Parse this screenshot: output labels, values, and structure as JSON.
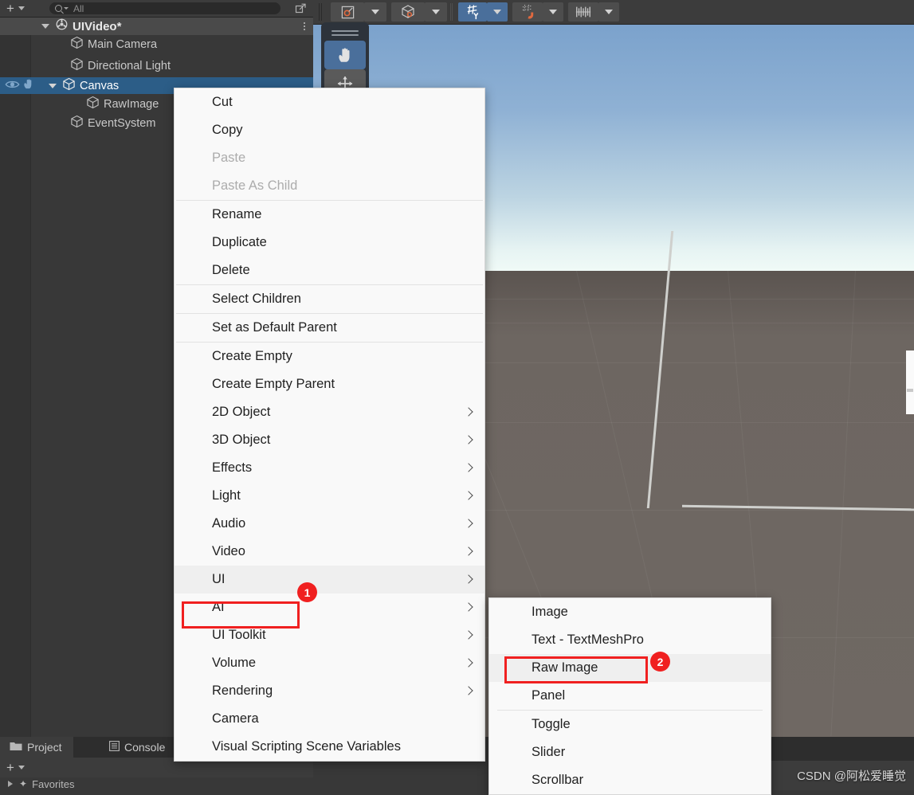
{
  "hierarchy": {
    "toolbar": {
      "add_label": "+",
      "search_value": "",
      "search_placeholder": "All",
      "expand_icon": "open-in-new-icon"
    },
    "scene_name": "UIVideo*",
    "items": [
      {
        "label": "Main Camera",
        "indent": 2,
        "selected": false,
        "expandable": false
      },
      {
        "label": "Directional Light",
        "indent": 2,
        "selected": false,
        "expandable": false
      },
      {
        "label": "Canvas",
        "indent": 2,
        "selected": true,
        "expandable": true
      },
      {
        "label": "RawImage",
        "indent": 3,
        "selected": false,
        "expandable": false
      },
      {
        "label": "EventSystem",
        "indent": 2,
        "selected": false,
        "expandable": false
      }
    ]
  },
  "project_panel": {
    "tabs": [
      {
        "label": "Project",
        "icon": "folder-icon",
        "active": true
      },
      {
        "label": "Console",
        "icon": "console-icon",
        "active": false
      }
    ],
    "add_label": "+",
    "favorites_label": "Favorites"
  },
  "scene_toolbar": {
    "buttons": [
      {
        "name": "gizmo-toggle",
        "icon": "gizmo-icon",
        "state": "normal"
      },
      {
        "name": "gizmo-dropdown",
        "icon": "chevron-down-icon",
        "state": "normal"
      },
      {
        "name": "render-mode",
        "icon": "cube-wire-icon",
        "state": "normal"
      },
      {
        "name": "render-mode-dropdown",
        "icon": "chevron-down-icon",
        "state": "normal"
      },
      {
        "name": "grid-snap-toggle",
        "icon": "grid-y-icon",
        "state": "active"
      },
      {
        "name": "grid-snap-dropdown",
        "icon": "chevron-down-icon",
        "state": "active"
      },
      {
        "name": "magnet-snap-toggle",
        "icon": "magnet-grid-icon",
        "state": "normal"
      },
      {
        "name": "magnet-snap-dropdown",
        "icon": "chevron-down-icon",
        "state": "normal"
      },
      {
        "name": "increment-snap",
        "icon": "ruler-icon",
        "state": "normal"
      },
      {
        "name": "increment-snap-dropdown",
        "icon": "chevron-down-icon",
        "state": "normal"
      }
    ]
  },
  "tool_palette": {
    "tools": [
      {
        "name": "hand-tool",
        "icon": "hand-icon",
        "selected": true
      },
      {
        "name": "move-tool",
        "icon": "move-arrows-icon",
        "selected": false
      }
    ]
  },
  "context_menu": {
    "items": [
      {
        "label": "Cut",
        "type": "item",
        "disabled": false,
        "submenu": false,
        "highlighted": false
      },
      {
        "label": "Copy",
        "type": "item",
        "disabled": false,
        "submenu": false,
        "highlighted": false
      },
      {
        "label": "Paste",
        "type": "item",
        "disabled": true,
        "submenu": false,
        "highlighted": false
      },
      {
        "label": "Paste As Child",
        "type": "item",
        "disabled": true,
        "submenu": false,
        "highlighted": false
      },
      {
        "label": "",
        "type": "separator"
      },
      {
        "label": "Rename",
        "type": "item",
        "disabled": false,
        "submenu": false,
        "highlighted": false
      },
      {
        "label": "Duplicate",
        "type": "item",
        "disabled": false,
        "submenu": false,
        "highlighted": false
      },
      {
        "label": "Delete",
        "type": "item",
        "disabled": false,
        "submenu": false,
        "highlighted": false
      },
      {
        "label": "",
        "type": "separator"
      },
      {
        "label": "Select Children",
        "type": "item",
        "disabled": false,
        "submenu": false,
        "highlighted": false
      },
      {
        "label": "",
        "type": "separator"
      },
      {
        "label": "Set as Default Parent",
        "type": "item",
        "disabled": false,
        "submenu": false,
        "highlighted": false
      },
      {
        "label": "",
        "type": "separator"
      },
      {
        "label": "Create Empty",
        "type": "item",
        "disabled": false,
        "submenu": false,
        "highlighted": false
      },
      {
        "label": "Create Empty Parent",
        "type": "item",
        "disabled": false,
        "submenu": false,
        "highlighted": false
      },
      {
        "label": "2D Object",
        "type": "item",
        "disabled": false,
        "submenu": true,
        "highlighted": false
      },
      {
        "label": "3D Object",
        "type": "item",
        "disabled": false,
        "submenu": true,
        "highlighted": false
      },
      {
        "label": "Effects",
        "type": "item",
        "disabled": false,
        "submenu": true,
        "highlighted": false
      },
      {
        "label": "Light",
        "type": "item",
        "disabled": false,
        "submenu": true,
        "highlighted": false
      },
      {
        "label": "Audio",
        "type": "item",
        "disabled": false,
        "submenu": true,
        "highlighted": false
      },
      {
        "label": "Video",
        "type": "item",
        "disabled": false,
        "submenu": true,
        "highlighted": false
      },
      {
        "label": "UI",
        "type": "item",
        "disabled": false,
        "submenu": true,
        "highlighted": true
      },
      {
        "label": "AI",
        "type": "item",
        "disabled": false,
        "submenu": true,
        "highlighted": false
      },
      {
        "label": "UI Toolkit",
        "type": "item",
        "disabled": false,
        "submenu": true,
        "highlighted": false
      },
      {
        "label": "Volume",
        "type": "item",
        "disabled": false,
        "submenu": true,
        "highlighted": false
      },
      {
        "label": "Rendering",
        "type": "item",
        "disabled": false,
        "submenu": true,
        "highlighted": false
      },
      {
        "label": "Camera",
        "type": "item",
        "disabled": false,
        "submenu": false,
        "highlighted": false
      },
      {
        "label": "Visual Scripting Scene Variables",
        "type": "item",
        "disabled": false,
        "submenu": false,
        "highlighted": false
      }
    ]
  },
  "submenu": {
    "items": [
      {
        "label": "Image",
        "type": "item",
        "highlighted": false
      },
      {
        "label": "Text - TextMeshPro",
        "type": "item",
        "highlighted": false
      },
      {
        "label": "Raw Image",
        "type": "item",
        "highlighted": true
      },
      {
        "label": "Panel",
        "type": "item",
        "highlighted": false
      },
      {
        "label": "",
        "type": "separator"
      },
      {
        "label": "Toggle",
        "type": "item",
        "highlighted": false
      },
      {
        "label": "Slider",
        "type": "item",
        "highlighted": false
      },
      {
        "label": "Scrollbar",
        "type": "item",
        "highlighted": false
      }
    ]
  },
  "annotations": {
    "badges": [
      {
        "number": "1",
        "target": "UI"
      },
      {
        "number": "2",
        "target": "Raw Image"
      }
    ],
    "highlight_color": "#f02020"
  },
  "watermark": {
    "text": "CSDN @阿松爱睡觉"
  }
}
